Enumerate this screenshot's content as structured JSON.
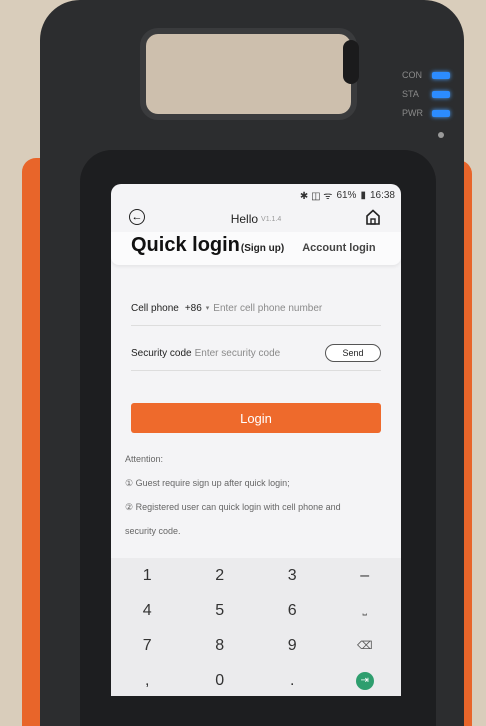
{
  "status": {
    "icons": "✱ ◫ ᯤ",
    "battery": "61%",
    "battery_icon": "▮",
    "time": "16:38"
  },
  "header": {
    "back_icon": "←",
    "title": "Hello",
    "version": "V1.1.4"
  },
  "tabs": {
    "quick": "Quick login",
    "signup": "(Sign up)",
    "account": "Account login"
  },
  "phone": {
    "label": "Cell phone",
    "country_code": "+86",
    "arrow": "▾",
    "placeholder": "Enter cell phone number"
  },
  "security": {
    "label": "Security code",
    "placeholder": "Enter security code",
    "send": "Send"
  },
  "login": {
    "label": "Login"
  },
  "attention": {
    "title": "Attention:",
    "line1": "① Guest require sign up after quick login;",
    "line2": "② Registered user can quick login with cell phone and",
    "line3": "security code."
  },
  "keypad": [
    "1",
    "2",
    "3",
    "–",
    "4",
    "5",
    "6",
    "⎵",
    "7",
    "8",
    "9",
    "⌫",
    ",",
    "0",
    "."
  ],
  "enter_icon": "⇥",
  "device": {
    "leds": [
      "CON",
      "STA",
      "PWR"
    ]
  },
  "colors": {
    "accent": "#ee6a2c",
    "led": "#2c8cff",
    "enter": "#2e9e6e"
  }
}
